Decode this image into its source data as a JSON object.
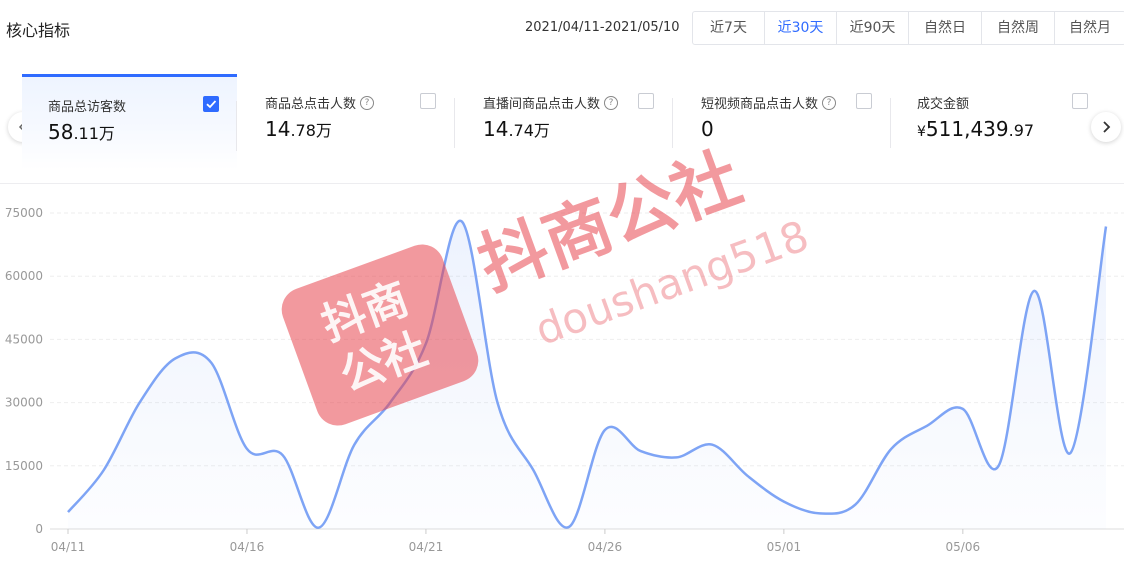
{
  "header": {
    "title": "核心指标",
    "date_range": "2021/04/11-2021/05/10",
    "periods": [
      {
        "label": "近7天",
        "active": false
      },
      {
        "label": "近30天",
        "active": true
      },
      {
        "label": "近90天",
        "active": false
      },
      {
        "label": "自然日",
        "active": false
      },
      {
        "label": "自然周",
        "active": false
      },
      {
        "label": "自然月",
        "active": false
      }
    ]
  },
  "metrics": [
    {
      "label": "商品总访客数",
      "help": false,
      "checked": true,
      "value_main": "58",
      "value_small": ".11万",
      "currency": ""
    },
    {
      "label": "商品总点击人数",
      "help": true,
      "checked": false,
      "value_main": "14",
      "value_small": ".78万",
      "currency": ""
    },
    {
      "label": "直播间商品点击人数",
      "help": true,
      "checked": false,
      "value_main": "14",
      "value_small": ".74万",
      "currency": ""
    },
    {
      "label": "短视频商品点击人数",
      "help": true,
      "checked": false,
      "value_main": "0",
      "value_small": "",
      "currency": ""
    },
    {
      "label": "成交金额",
      "help": false,
      "checked": false,
      "value_main": "511,439",
      "value_small": ".97",
      "currency": "¥"
    }
  ],
  "watermark": {
    "stamp_text": "抖商公社",
    "brand_text": "抖商公社",
    "url_text": "doushang518",
    "color": "#e8464f"
  },
  "colors": {
    "accent": "#2f6bff",
    "line": "#7ea4f5",
    "grid": "#eeeeee",
    "axis_text": "#999999"
  },
  "chart_data": {
    "type": "area",
    "title": "",
    "xlabel": "",
    "ylabel": "",
    "ylim": [
      0,
      75000
    ],
    "yticks": [
      0,
      15000,
      30000,
      45000,
      60000,
      75000
    ],
    "xtick_labels": [
      "04/11",
      "04/16",
      "04/21",
      "04/26",
      "05/01",
      "05/06"
    ],
    "grid": true,
    "x": [
      "04/11",
      "04/12",
      "04/13",
      "04/14",
      "04/15",
      "04/16",
      "04/17",
      "04/18",
      "04/19",
      "04/20",
      "04/21",
      "04/22",
      "04/23",
      "04/24",
      "04/25",
      "04/26",
      "04/27",
      "04/28",
      "04/29",
      "04/30",
      "05/01",
      "05/02",
      "05/03",
      "05/04",
      "05/05",
      "05/06",
      "05/07",
      "05/08",
      "05/09",
      "05/10"
    ],
    "series": [
      {
        "values": [
          4000,
          14000,
          30000,
          40500,
          39500,
          19000,
          17500,
          300,
          20000,
          30000,
          44000,
          73000,
          30000,
          14000,
          500,
          23500,
          18500,
          17000,
          20000,
          12500,
          6500,
          3700,
          5800,
          19000,
          24500,
          28500,
          15000,
          56500,
          18000,
          71800
        ]
      }
    ]
  }
}
